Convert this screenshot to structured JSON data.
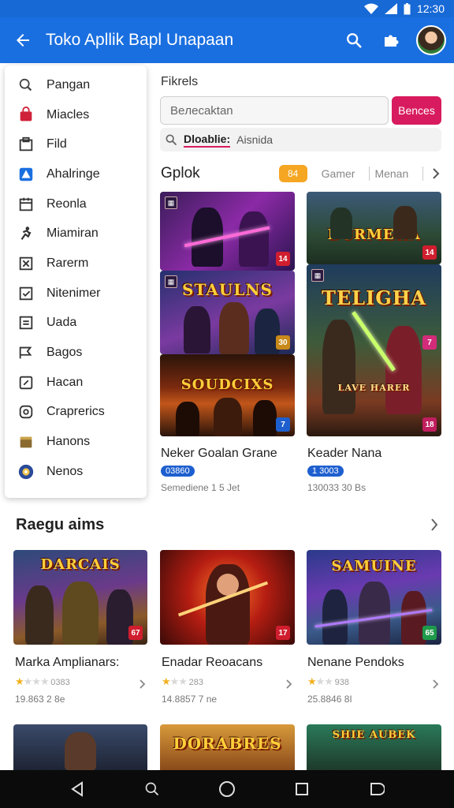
{
  "status_bar": {
    "time": "12:30"
  },
  "app_bar": {
    "title": "Toko Apllik Bapl Unapaan"
  },
  "drawer": {
    "items": [
      {
        "label": "Pangan",
        "icon": "search-icon",
        "color": "#444444"
      },
      {
        "label": "Miacles",
        "icon": "bag-icon",
        "color": "#d0213a"
      },
      {
        "label": "Fild",
        "icon": "folder-icon",
        "color": "#333333"
      },
      {
        "label": "Ahalringe",
        "icon": "triangle-app-icon",
        "color": "#1a6fe0"
      },
      {
        "label": "Reonla",
        "icon": "calendar-icon",
        "color": "#333333"
      },
      {
        "label": "Miamiran",
        "icon": "runner-icon",
        "color": "#333333"
      },
      {
        "label": "Rarerm",
        "icon": "cross-box-icon",
        "color": "#333333"
      },
      {
        "label": "Nitenimer",
        "icon": "check-box-icon",
        "color": "#333333"
      },
      {
        "label": "Uada",
        "icon": "list-box-icon",
        "color": "#333333"
      },
      {
        "label": "Bagos",
        "icon": "flag-icon",
        "color": "#333333"
      },
      {
        "label": "Hacan",
        "icon": "edit-box-icon",
        "color": "#333333"
      },
      {
        "label": "Craprerics",
        "icon": "ring-icon",
        "color": "#333333"
      },
      {
        "label": "Hanons",
        "icon": "gift-icon",
        "color": "#8a6a2f"
      },
      {
        "label": "Nenos",
        "icon": "globe-icon",
        "color": "#2b4a9a"
      }
    ]
  },
  "filter": {
    "label": "Fikrels",
    "search_placeholder": "Beлecaktan",
    "search_button": "Bences",
    "chips": {
      "active": "Dloablie:",
      "inactive": "Aisnida"
    }
  },
  "category": {
    "title": "Gplok",
    "badge": "84",
    "tabs": [
      "Gamer",
      "Menan"
    ]
  },
  "top_games": [
    {
      "title": "Neker Goalan Grane",
      "rating": "03860",
      "meta": "Semediene 1 5 Jet",
      "art_top": "",
      "art_bottom": "SOUDCIXS",
      "art_mid": "STAULNS",
      "badges": [
        "14",
        "30",
        "7"
      ]
    },
    {
      "title": "Keader Nana",
      "rating": "1 3003",
      "meta": "130033 30 Bs",
      "art_top": "DURMEHA",
      "art_mid": "TELIGHA",
      "art_bottom": "LAVE HARER",
      "badges": [
        "14",
        "7",
        "18"
      ]
    }
  ],
  "rekomendasi": {
    "title": "Raegu aims",
    "games": [
      {
        "title": "Marka Amplianars:",
        "stars_full": 1,
        "rating_text": "0383",
        "meta": "19.863 2 8e",
        "art": "DARCAIS",
        "badge": "67"
      },
      {
        "title": "Enadar Reoacans",
        "stars_full": 1,
        "rating_text": "283",
        "meta": "14.8857 7 ne",
        "art": "",
        "badge": "17"
      },
      {
        "title": "Nenane Pendoks",
        "stars_full": 1,
        "rating_text": "938",
        "meta": "25.8846 8I",
        "art": "SAMUINE",
        "badge": "65"
      }
    ],
    "next_row_art": [
      "",
      "DORABRES",
      "SHIE AUBEK"
    ]
  },
  "colors": {
    "app_bar": "#1a6fe0",
    "accent": "#d81b5e",
    "badge": "#f5a623",
    "rating_pill": "#1e5fcf",
    "star": "#f2b01e"
  }
}
